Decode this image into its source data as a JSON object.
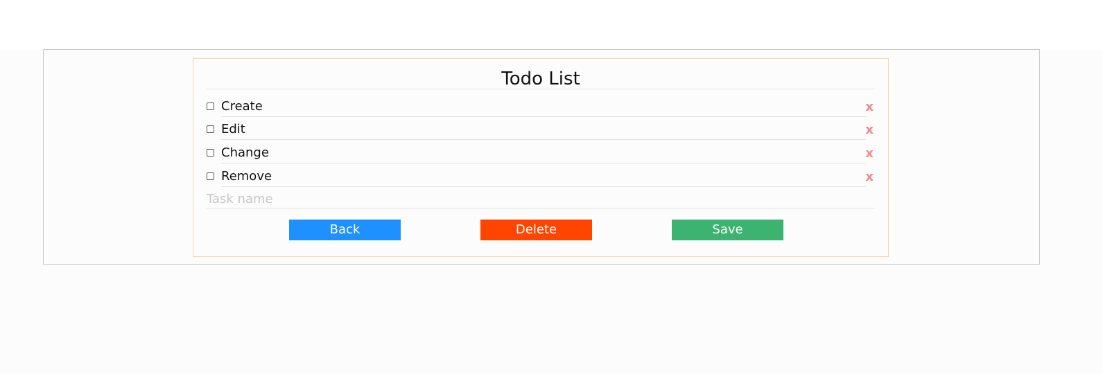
{
  "todo": {
    "title": "Todo List",
    "tasks": [
      {
        "label": "Create",
        "checked": false,
        "delete_label": "x"
      },
      {
        "label": "Edit",
        "checked": false,
        "delete_label": "x"
      },
      {
        "label": "Change",
        "checked": false,
        "delete_label": "x"
      },
      {
        "label": "Remove",
        "checked": false,
        "delete_label": "x"
      }
    ],
    "new_task": {
      "value": "",
      "placeholder": "Task name"
    }
  },
  "actions": {
    "back_label": "Back",
    "delete_label": "Delete",
    "save_label": "Save"
  },
  "colors": {
    "back": "#1e90ff",
    "delete": "#ff4500",
    "save": "#3cb371",
    "remove_x": "#f28b8b",
    "card_border": "#f3dba4"
  }
}
